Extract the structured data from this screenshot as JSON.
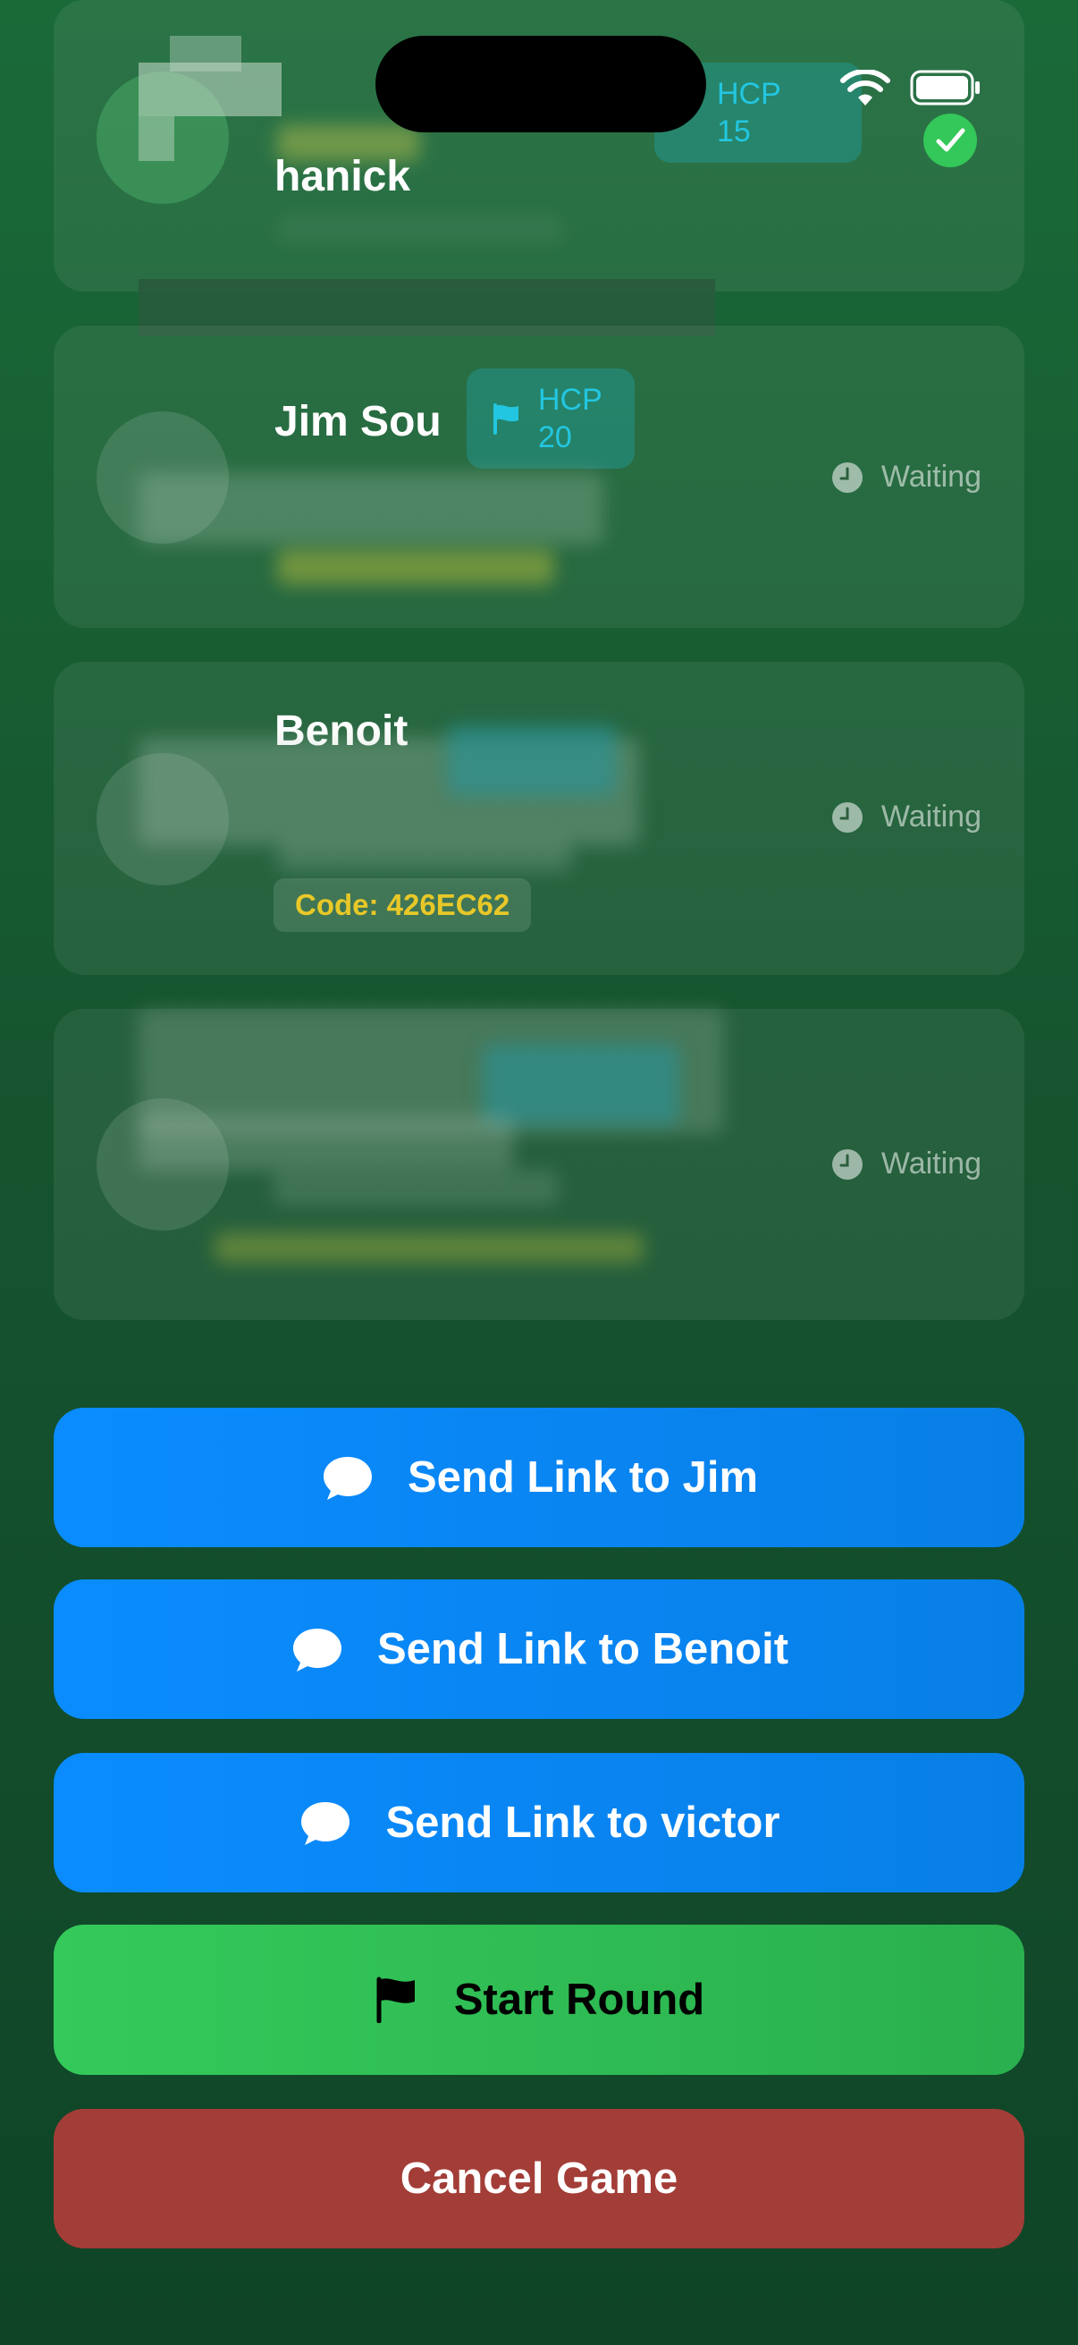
{
  "players": [
    {
      "name": "hanick",
      "hcp_label": "HCP",
      "hcp_value": "15",
      "status": "confirmed",
      "status_icon": "check-circle-icon"
    },
    {
      "name": "Jim Sou",
      "hcp_label": "HCP",
      "hcp_value": "20",
      "status": "Waiting",
      "status_icon": "clock-icon"
    },
    {
      "name": "Benoit",
      "status": "Waiting",
      "status_icon": "clock-icon",
      "code": "Code: 426EC62"
    },
    {
      "status": "Waiting",
      "status_icon": "clock-icon"
    }
  ],
  "actions": {
    "send_jim": "Send Link to Jim",
    "send_benoit": "Send Link to Benoit",
    "send_victor": "Send Link to victor",
    "start_round": "Start Round",
    "cancel_game": "Cancel Game"
  },
  "colors": {
    "background": "#16552f",
    "send_button": "#0a8cff",
    "start_button": "#34c95a",
    "cancel_button": "#a33d37",
    "hcp_text": "#23c6e0",
    "code_text": "#e8c828",
    "confirmed": "#34c759"
  }
}
